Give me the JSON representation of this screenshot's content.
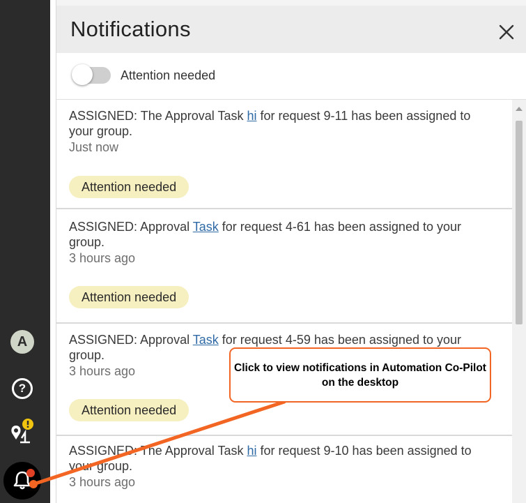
{
  "sidebar": {
    "avatar_initial": "A",
    "help_glyph": "?",
    "icons": [
      "help-icon",
      "location-alert-icon",
      "bell-icon"
    ]
  },
  "panel": {
    "title": "Notifications",
    "close_glyph": "×",
    "filter": {
      "label": "Attention needed",
      "enabled": false
    }
  },
  "notifications": [
    {
      "before_link": "ASSIGNED: The Approval Task ",
      "link": "hi",
      "after_link": " for request 9-11 has been assigned to your group.",
      "time": "Just now",
      "badge": "Attention needed"
    },
    {
      "before_link": "ASSIGNED: Approval ",
      "link": "Task",
      "after_link": " for request 4-61 has been assigned to your group.",
      "time": "3 hours ago",
      "badge": "Attention needed"
    },
    {
      "before_link": "ASSIGNED: Approval ",
      "link": "Task",
      "after_link": " for request 4-59 has been assigned to your group.",
      "time": "3 hours ago",
      "badge": "Attention needed"
    },
    {
      "before_link": "ASSIGNED: The Approval Task ",
      "link": "hi",
      "after_link": " for request 9-10 has been assigned to your group.",
      "time": "3 hours ago",
      "badge": ""
    }
  ],
  "callout": {
    "text": "Click to view notifications in Automation Co-Pilot on the desktop"
  },
  "colors": {
    "accent_orange": "#f26522",
    "badge_yellow": "#f6efc0",
    "sidebar": "#2b2b2b",
    "link_blue": "#2f6aa6",
    "notification_dot": "#e04124"
  }
}
